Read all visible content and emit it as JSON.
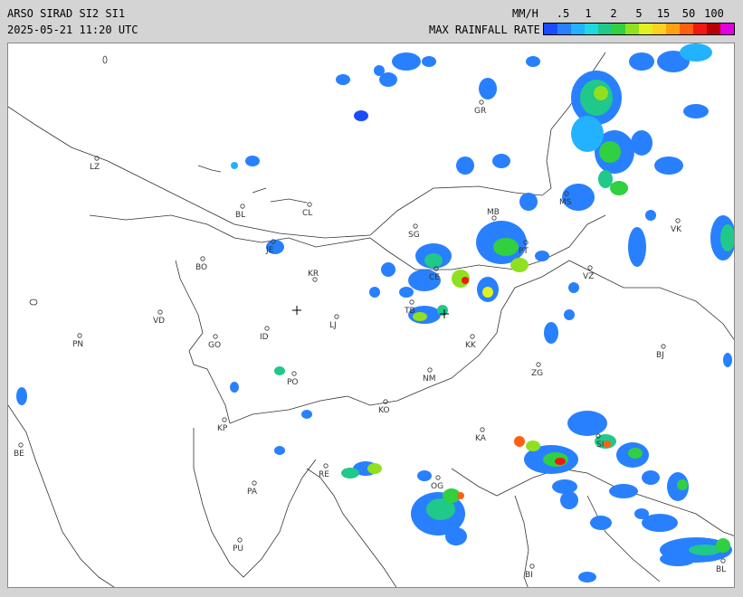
{
  "header": {
    "title": "ARSO SIRAD SI2 SI1",
    "timestamp": "2025-05-21 11:20 UTC",
    "product": "MAX RAINFALL RATE"
  },
  "legend": {
    "units": "MM/H",
    "ticks": [
      ".5",
      "1",
      "2",
      "5",
      "15",
      "50",
      "100"
    ],
    "colors": [
      "#1a4cff",
      "#2880ff",
      "#22b2ff",
      "#20d8e0",
      "#20c88a",
      "#30d040",
      "#90e020",
      "#e0f020",
      "#ffd020",
      "#ffa010",
      "#ff6010",
      "#f01810",
      "#b80000",
      "#e000e0"
    ]
  },
  "cities": [
    {
      "code": "GR"
    },
    {
      "code": "LZ"
    },
    {
      "code": "BL"
    },
    {
      "code": "CL"
    },
    {
      "code": "MB"
    },
    {
      "code": "MS"
    },
    {
      "code": "VK"
    },
    {
      "code": "JE"
    },
    {
      "code": "SG"
    },
    {
      "code": "PT"
    },
    {
      "code": "BO"
    },
    {
      "code": "KR"
    },
    {
      "code": "CE"
    },
    {
      "code": "VZ"
    },
    {
      "code": "TB"
    },
    {
      "code": "VD"
    },
    {
      "code": "LJ"
    },
    {
      "code": "PN"
    },
    {
      "code": "GO"
    },
    {
      "code": "ID"
    },
    {
      "code": "KK"
    },
    {
      "code": "BJ"
    },
    {
      "code": "ZG"
    },
    {
      "code": "PO"
    },
    {
      "code": "NM"
    },
    {
      "code": "KO"
    },
    {
      "code": "KP"
    },
    {
      "code": "KA"
    },
    {
      "code": "SI"
    },
    {
      "code": "BE"
    },
    {
      "code": "RE"
    },
    {
      "code": "OG"
    },
    {
      "code": "PA"
    },
    {
      "code": "PU"
    },
    {
      "code": "BI"
    },
    {
      "code": "BL"
    }
  ]
}
